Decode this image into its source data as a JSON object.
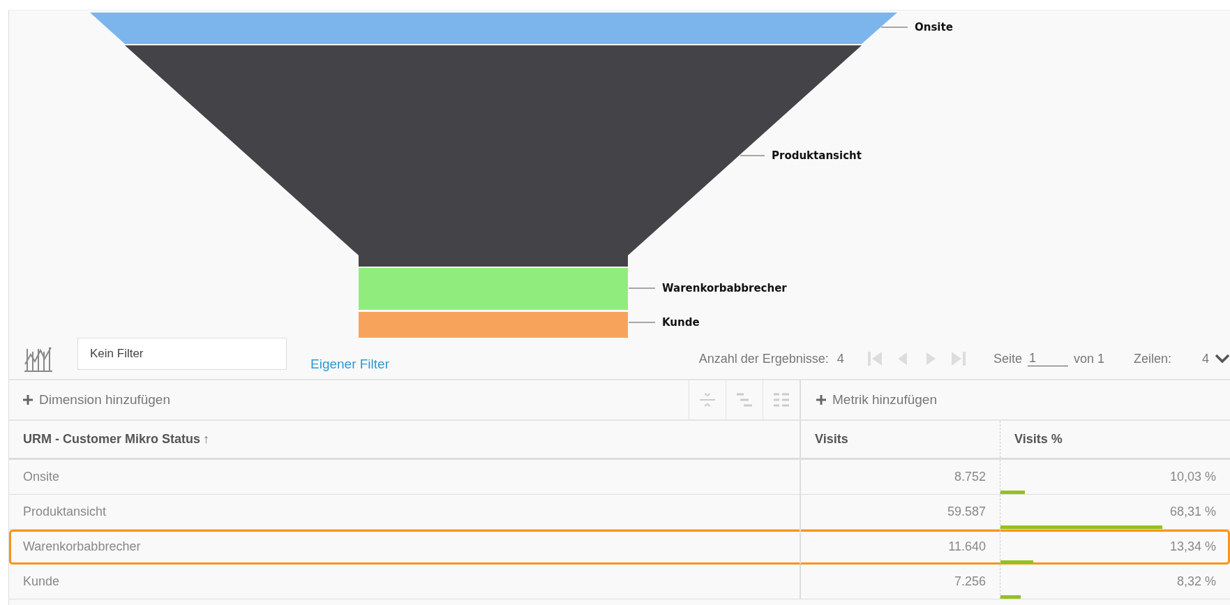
{
  "funnel": {
    "stages": [
      {
        "label": "Onsite",
        "color": "#7cb5ec"
      },
      {
        "label": "Produktansicht",
        "color": "#434348"
      },
      {
        "label": "Warenkorbabbrecher",
        "color": "#90ed7d"
      },
      {
        "label": "Kunde",
        "color": "#f7a35c"
      }
    ]
  },
  "toolbar": {
    "filter": {
      "value": "Kein Filter"
    },
    "custom_filter_link": "Eigener Filter",
    "results_label": "Anzahl der Ergebnisse:",
    "results_count": "4",
    "nav_buttons": [
      {
        "kind": "first",
        "disabled": true
      },
      {
        "kind": "prev",
        "disabled": true
      },
      {
        "kind": "next",
        "disabled": true
      },
      {
        "kind": "last",
        "disabled": true
      }
    ],
    "page_label": "Seite",
    "page": {
      "value": "1"
    },
    "page_of": "von 1",
    "rows_label": "Zeilen:",
    "rows_value": "4"
  },
  "table": {
    "add_dimension": "Dimension hinzufügen",
    "add_metric": "Metrik hinzufügen",
    "columns": [
      {
        "label": "URM - Customer Mikro Status",
        "sort": "↑"
      },
      {
        "label": "Visits"
      },
      {
        "label": "Visits %"
      }
    ],
    "rows": [
      {
        "status": "Onsite",
        "visits": "8.752",
        "visits_pct": "10,03 %",
        "highlighted": false
      },
      {
        "status": "Produktansicht",
        "visits": "59.587",
        "visits_pct": "68,31 %",
        "highlighted": false
      },
      {
        "status": "Warenkorbabbrecher",
        "visits": "11.640",
        "visits_pct": "13,34 %",
        "highlighted": true
      },
      {
        "status": "Kunde",
        "visits": "7.256",
        "visits_pct": "8,32 %",
        "highlighted": false
      }
    ]
  }
}
